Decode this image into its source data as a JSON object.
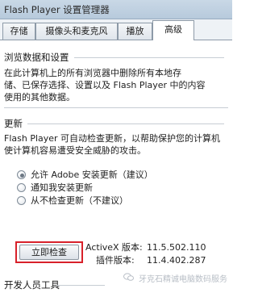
{
  "window": {
    "title": "Flash Player 设置管理器"
  },
  "tabs": [
    {
      "label": "存储",
      "active": false
    },
    {
      "label": "摄像头和麦克风",
      "active": false
    },
    {
      "label": "播放",
      "active": false
    },
    {
      "label": "高级",
      "active": true
    }
  ],
  "browsing": {
    "title": "浏览数据和设置",
    "description_lines": [
      "在此计算机上的所有浏览器中删除所有本地存",
      "储、已保存选择、设置以及 Flash Player 中的内容",
      "使用的其他数据。"
    ]
  },
  "updates": {
    "title": "更新",
    "description_lines": [
      "Flash Player 可自动检查更新，以帮助保护您的计算机",
      "使计算机容易遭受安全威胁的攻击。"
    ],
    "options": [
      {
        "label": "允许 Adobe 安装更新（建议）",
        "selected": true
      },
      {
        "label": "通知我安装更新",
        "selected": false
      },
      {
        "label": "从不检查更新（不建议）",
        "selected": false
      }
    ],
    "check_now_label": "立即检查",
    "activex_label": "ActiveX 版本:",
    "activex_version": "11.5.502.110",
    "plugin_label": "插件版本:",
    "plugin_version": "11.4.402.287"
  },
  "developer": {
    "title": "开发人员工具"
  },
  "watermark": {
    "text": "牙克石精诚电脑数码服务"
  },
  "colors": {
    "highlight_border": "#d8212a",
    "titlebar": "#c9d8e6"
  }
}
